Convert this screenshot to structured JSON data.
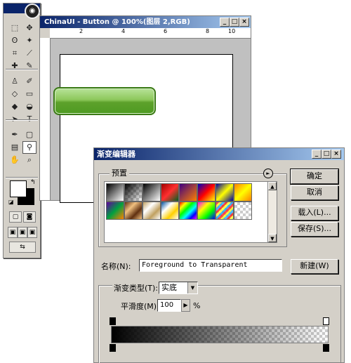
{
  "toolbox": {
    "tools": [
      {
        "name": "marquee-tool-icon",
        "glyph": "⬚"
      },
      {
        "name": "move-tool-icon",
        "glyph": "✥"
      },
      {
        "name": "lasso-tool-icon",
        "glyph": "ʘ"
      },
      {
        "name": "magic-wand-tool-icon",
        "glyph": "✦"
      },
      {
        "name": "crop-tool-icon",
        "glyph": "⌗"
      },
      {
        "name": "slice-tool-icon",
        "glyph": "⟋"
      },
      {
        "name": "healing-brush-tool-icon",
        "glyph": "✚"
      },
      {
        "name": "brush-tool-icon",
        "glyph": "✎"
      },
      {
        "name": "clone-stamp-tool-icon",
        "glyph": "♙"
      },
      {
        "name": "history-brush-tool-icon",
        "glyph": "✐"
      },
      {
        "name": "eraser-tool-icon",
        "glyph": "◇"
      },
      {
        "name": "gradient-tool-icon",
        "glyph": "▭"
      },
      {
        "name": "blur-tool-icon",
        "glyph": "◆"
      },
      {
        "name": "dodge-tool-icon",
        "glyph": "◒"
      },
      {
        "name": "path-selection-tool-icon",
        "glyph": "➤"
      },
      {
        "name": "type-tool-icon",
        "glyph": "T"
      },
      {
        "name": "pen-tool-icon",
        "glyph": "✒"
      },
      {
        "name": "shape-tool-icon",
        "glyph": "▢"
      },
      {
        "name": "notes-tool-icon",
        "glyph": "▤"
      },
      {
        "name": "eyedropper-tool-icon",
        "glyph": "⚲"
      },
      {
        "name": "hand-tool-icon",
        "glyph": "✋"
      },
      {
        "name": "zoom-tool-icon",
        "glyph": "⌕"
      }
    ],
    "colors": {
      "foreground": "#ffffff",
      "background": "#000000"
    }
  },
  "document": {
    "title": "ChinaUI - Button @ 100%(图层 2,RGB)",
    "ruler_labels": [
      "2",
      "4",
      "6",
      "8",
      "10"
    ],
    "button_colors": {
      "top": "#b8e39a",
      "bottom": "#4e9a22",
      "border": "#3b7a16"
    }
  },
  "window_buttons": {
    "minimize": "_",
    "maximize": "□",
    "close": "×"
  },
  "gradient_editor": {
    "title": "渐变编辑器",
    "presets_label": "预置",
    "buttons": {
      "ok": "确定",
      "cancel": "取消",
      "load": "载入(L)...",
      "save": "保存(S)...",
      "new": "新建(W)"
    },
    "name_label": "名称(N):",
    "name_value": "Foreground to Transparent",
    "type_label": "渐变类型(T):",
    "type_value": "实底",
    "smooth_label": "平滑度(M):",
    "smooth_value": "100",
    "smooth_unit": "%",
    "menu_icon": "►"
  }
}
